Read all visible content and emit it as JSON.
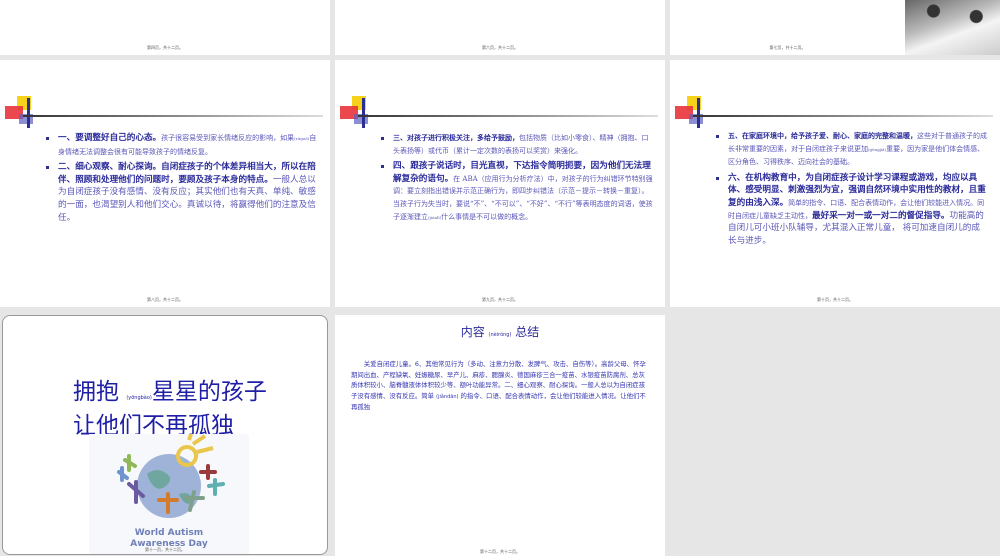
{
  "slides": [
    {
      "footer": "第四页，共十二页。"
    },
    {
      "footer": "第六页，共十二页。"
    },
    {
      "footer": "第七页，共十二页。"
    },
    {
      "footer": "第八页，共十二页。",
      "items": [
        {
          "bold": "一、要调整好自己的心态。",
          "text": "孩子很容易受到家长情绪反应的影响，如果",
          "pinyin": "(rúguǒ)",
          "text2": "自身情绪无法调整会很有可能导致孩子的情绪反复。"
        },
        {
          "bold": "二、细心观察、耐心探询。自闭症孩子的个体差异相当大，所以在陪伴、照顾和处理他们的问题时，要顾及孩子本身的特点。",
          "text": "一般人总以为自闭症孩子没有感情、没有反应；其实他们也有天真、单纯、敏感的一面，也渴望别人和他们交心。真诚以待，将赢得他们的注意及信任。"
        }
      ]
    },
    {
      "footer": "第九页，共十二页。",
      "items": [
        {
          "bold": "三、对孩子进行积极关注，多给予鼓励，",
          "text": "包括物质（比如小零食）、精神（拥抱、口头表扬等）或代币（累计一定次数的表扬可以奖赏）来强化。"
        },
        {
          "bold": "四、跟孩子说话时，目光直视，下达指令简明扼要，因为他们无法理解复杂的语句。",
          "text": "在 ABA（应用行为分析疗法）中，对孩子的行为纠错环节特别强调：要立刻指出错误并示范正确行为，即四步纠错法（示范－提示－转换－重复）。当孩子行为失当时，要说“不”、“不可以”、“不好”、“不行”等表明态度的词语，使孩子逐渐建立",
          "pinyin": "(jiànlì)",
          "text2": "什么事情是不可以做的概念。"
        }
      ]
    },
    {
      "footer": "第十页，共十二页。",
      "items": [
        {
          "bold": "五、在家庭环境中，给予孩子爱、耐心、家庭的完整和温暖，",
          "text": "这些对于普通孩子的成长非常重要的因素，对于自闭症孩子来说更加",
          "pinyin": "(gèngjiā)",
          "text2": "重要，因为家是他们体会情感、区分角色、习得秩序、迈向社会的基础。"
        },
        {
          "bold": "六、在机构教育中，为自闭症孩子设计学习课程或游戏，均应以具体、感受明显、刺激强烈为宜，强调自然环境中实用性的教材，且重复的由浅入深。",
          "text": "简单的指令、口语、配合表情动作，会让他们较能进入情况。同时自闭症儿童缺乏主动性，",
          "bold2": "最好采一对一或一对二的督促指导。",
          "text2": "功能高的自闭儿可小班小队辅导，尤其混入正常儿童， 将可加速自闭儿的成长与进步。"
        }
      ]
    },
    {
      "footer": "第十一页，共十二页。",
      "title1": "拥抱",
      "pinyin": "(yōngbào)",
      "title2": "星星的孩子",
      "title3": "让他们不再孤独",
      "logo_line1": "World Autism",
      "logo_line2": "Awareness Day"
    },
    {
      "footer": "第十二页，共十二页。",
      "title": "内容",
      "title_pinyin": "(nèiróng)",
      "title2": "总结",
      "text": "关爱自闭症儿童。6、其他常见行为（多动、注意力分散、发脾气、攻击、自伤等）。高龄父母、怀孕期间出血、产程缺氧、妊娠糖尿、早产儿、麻疹、腮腺炎、德国麻疹三合一疫苗、水银疫苗防腐剂、总灰质体积较小、脑脊髓液体体积较少等、额叶功能异常。二、细心观察、耐心探询。一般人总以为自闭症孩子没有感情、没有反应。简单",
      "text_pinyin": "(jiǎndān)",
      "text2": "的指令、口语、配合表情动作，会让他们较能进入情况。让他们不再孤独"
    }
  ]
}
